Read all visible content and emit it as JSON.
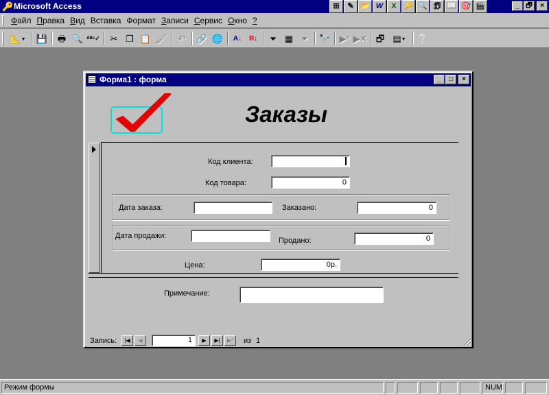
{
  "app": {
    "title": "Microsoft Access",
    "window_buttons": [
      "_",
      "🗗",
      "×"
    ]
  },
  "office_bar": [
    "⊞",
    "✎",
    "📂",
    "W",
    "X",
    "🔑",
    "🔍",
    "🗊",
    "📖",
    "🎯",
    "🎬"
  ],
  "menu": {
    "items": [
      {
        "u": "Ф",
        "rest": "айл"
      },
      {
        "u": "П",
        "rest": "равка"
      },
      {
        "u": "В",
        "rest": "ид"
      },
      {
        "u": "",
        "rest": "Вставка"
      },
      {
        "u": "",
        "rest": "Формат"
      },
      {
        "u": "З",
        "rest": "аписи"
      },
      {
        "u": "С",
        "rest": "ервис"
      },
      {
        "u": "О",
        "rest": "кно"
      },
      {
        "u": "?",
        "rest": ""
      }
    ]
  },
  "toolbar": {
    "icons": [
      "design-view-icon",
      "save-icon",
      "print-icon",
      "print-preview-icon",
      "spelling-icon",
      "cut-icon",
      "copy-icon",
      "paste-icon",
      "format-painter-icon",
      "undo-icon",
      "hyperlink-icon",
      "web-icon",
      "sort-ascending-icon",
      "sort-descending-icon",
      "filter-by-selection-icon",
      "filter-by-form-icon",
      "apply-filter-icon",
      "find-icon",
      "new-record-icon",
      "delete-record-icon",
      "database-window-icon",
      "new-object-icon",
      "help-icon"
    ]
  },
  "form_window": {
    "title": "Форма1 : форма",
    "window_buttons": [
      "_",
      "□",
      "×"
    ],
    "header_title": "Заказы",
    "fields": {
      "client_code": {
        "label": "Код клиента:",
        "value": ""
      },
      "product_code": {
        "label": "Код товара:",
        "value": "0"
      },
      "order_date": {
        "label": "Дата заказа:",
        "value": ""
      },
      "ordered": {
        "label": "Заказано:",
        "value": "0"
      },
      "sale_date": {
        "label": "Дата продажи:",
        "value": ""
      },
      "sold": {
        "label": "Продано:",
        "value": "0"
      },
      "price": {
        "label": "Цена:",
        "value": "0р."
      },
      "note": {
        "label": "Примечание:",
        "value": ""
      }
    },
    "nav": {
      "label": "Запись:",
      "current": "1",
      "of_label": "из",
      "total": "1",
      "first": "|◀",
      "prev": "◀",
      "next": "▶",
      "last": "▶|",
      "new": "▶*"
    }
  },
  "statusbar": {
    "mode": "Режим формы",
    "num": "NUM"
  }
}
